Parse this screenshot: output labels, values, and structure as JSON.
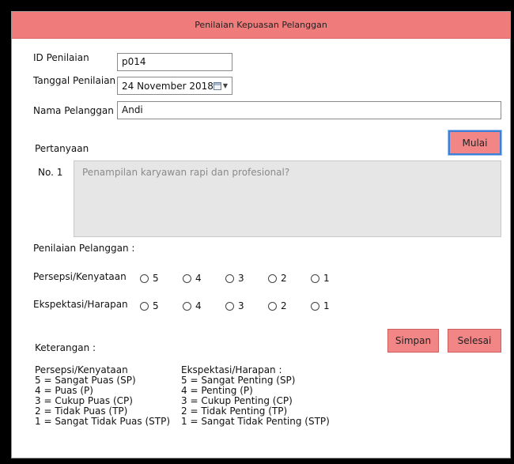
{
  "window": {
    "title": "Penilaian Kepuasan Pelanggan"
  },
  "form": {
    "id_label": "ID Penilaian",
    "id_value": "p014",
    "date_label": "Tanggal Penilaian",
    "date_value": "24 November  2018",
    "name_label": "Nama Pelanggan",
    "name_value": "Andi"
  },
  "question": {
    "section_label": "Pertanyaan",
    "start_button": "Mulai",
    "number": "No. 1",
    "text": "Penampilan karyawan rapi dan profesional?"
  },
  "rating": {
    "heading": "Penilaian Pelanggan :",
    "perception_label": "Persepsi/Kenyataan",
    "expectation_label": "Ekspektasi/Harapan",
    "options": [
      "5",
      "4",
      "3",
      "2",
      "1"
    ]
  },
  "actions": {
    "save": "Simpan",
    "finish": "Selesai"
  },
  "notes": {
    "heading": "Keterangan :",
    "perception": {
      "title": "Persepsi/Kenyataan",
      "items": [
        "5 = Sangat Puas (SP)",
        "4 = Puas (P)",
        "3 = Cukup Puas (CP)",
        "2 = Tidak Puas (TP)",
        "1 = Sangat Tidak Puas (STP)"
      ]
    },
    "expectation": {
      "title": "Ekspektasi/Harapan :",
      "items": [
        "5 = Sangat Penting (SP)",
        "4 = Penting (P)",
        "3 = Cukup Penting (CP)",
        "2 = Tidak Penting (TP)",
        "1 = Sangat Tidak Penting (STP)"
      ]
    }
  },
  "colors": {
    "accent": "#f07b7b",
    "button": "#f28686",
    "focus": "#3d7fd6"
  }
}
